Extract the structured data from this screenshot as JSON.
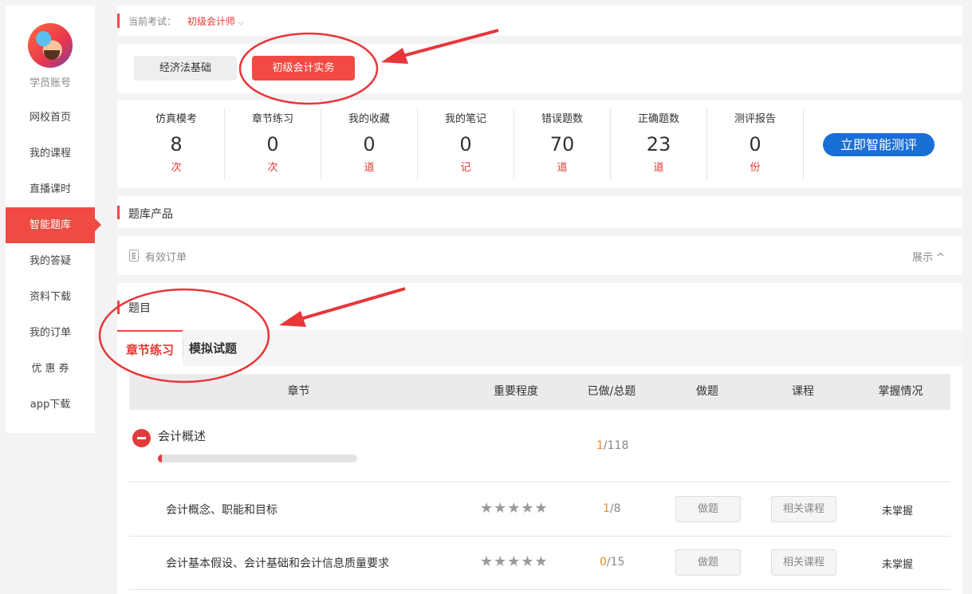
{
  "sidebar": {
    "account_label": "学员账号",
    "items": [
      {
        "label": "网校首页",
        "active": false
      },
      {
        "label": "我的课程",
        "active": false
      },
      {
        "label": "直播课时",
        "active": false
      },
      {
        "label": "智能题库",
        "active": true
      },
      {
        "label": "我的答疑",
        "active": false
      },
      {
        "label": "资料下载",
        "active": false
      },
      {
        "label": "我的订单",
        "active": false
      },
      {
        "label": "优 惠 券",
        "active": false
      },
      {
        "label": "app下载",
        "active": false
      }
    ]
  },
  "exam": {
    "label": "当前考试：",
    "value": "初级会计师",
    "caret": "⌵"
  },
  "subjects": [
    "经济法基础",
    "初级会计实务"
  ],
  "stats": [
    {
      "name": "仿真模考",
      "value": "8",
      "unit": "次"
    },
    {
      "name": "章节练习",
      "value": "0",
      "unit": "次"
    },
    {
      "name": "我的收藏",
      "value": "0",
      "unit": "道"
    },
    {
      "name": "我的笔记",
      "value": "0",
      "unit": "记"
    },
    {
      "name": "错误题数",
      "value": "70",
      "unit": "道"
    },
    {
      "name": "正确题数",
      "value": "23",
      "unit": "道"
    },
    {
      "name": "测评报告",
      "value": "0",
      "unit": "份"
    }
  ],
  "cta_label": "立即智能测评",
  "product_title": "题库产品",
  "orders": {
    "label": "有效订单",
    "toggle": "展示 ^"
  },
  "questions": {
    "title": "题目",
    "tabs": [
      "章节练习",
      "模拟试题"
    ],
    "columns": [
      "章节",
      "重要程度",
      "已做/总题",
      "做题",
      "课程",
      "掌握情况"
    ],
    "chapter": {
      "name": "会计概述",
      "done": "1",
      "total": "/118",
      "progress": 0.0085
    },
    "rows": [
      {
        "name": "会计概念、职能和目标",
        "stars": "★★★★★",
        "done": "1",
        "total": "/8",
        "do_label": "做题",
        "course_label": "相关课程",
        "mastery": "未掌握"
      },
      {
        "name": "会计基本假设、会计基础和会计信息质量要求",
        "stars": "★★★★★",
        "done": "0",
        "total": "/15",
        "do_label": "做题",
        "course_label": "相关课程",
        "mastery": "未掌握"
      }
    ]
  },
  "colors": {
    "accent": "#f04a42",
    "cta": "#1a6fd6",
    "done": "#f08a2a"
  }
}
